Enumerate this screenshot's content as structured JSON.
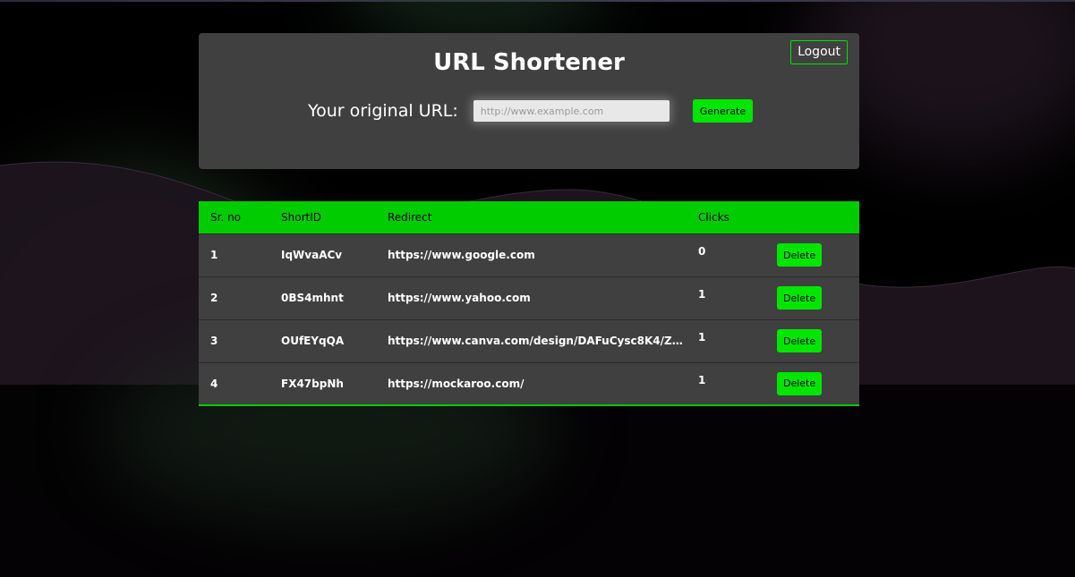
{
  "header": {
    "title": "URL Shortener",
    "logout_label": "Logout",
    "url_label": "Your original URL:",
    "url_placeholder": "http://www.example.com",
    "url_value": "",
    "generate_label": "Generate"
  },
  "table": {
    "columns": [
      "Sr. no",
      "ShortID",
      "Redirect",
      "Clicks",
      ""
    ],
    "rows": [
      {
        "sr": "1",
        "short_id": "IqWvaACv",
        "redirect": "https://www.google.com",
        "clicks": "0",
        "action": "Delete"
      },
      {
        "sr": "2",
        "short_id": "0BS4mhnt",
        "redirect": "https://www.yahoo.com",
        "clicks": "1",
        "action": "Delete"
      },
      {
        "sr": "3",
        "short_id": "OUfEYqQA",
        "redirect": "https://www.canva.com/design/DAFuCysc8K4/Z0...",
        "clicks": "1",
        "action": "Delete"
      },
      {
        "sr": "4",
        "short_id": "FX47bpNh",
        "redirect": "https://mockaroo.com/",
        "clicks": "1",
        "action": "Delete"
      }
    ]
  },
  "colors": {
    "accent": "#00e600",
    "header_green": "#00cc00",
    "panel": "#404040",
    "background": "#000000"
  }
}
